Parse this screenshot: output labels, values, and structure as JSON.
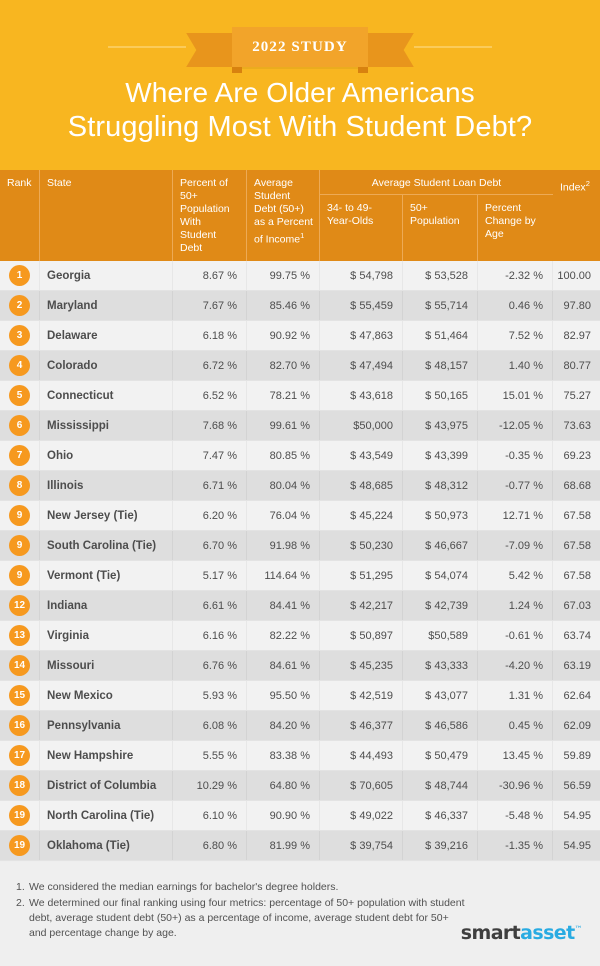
{
  "banner": {
    "ribbon_label": "2022 STUDY",
    "title_line1": "Where Are Older Americans",
    "title_line2": "Struggling Most With Student Debt?",
    "bg_color": "#F8B620",
    "ribbon_color": "#F2A42A"
  },
  "table": {
    "header": {
      "rank": "Rank",
      "state": "State",
      "percent_pop": "Percent of 50+ Population With Student Debt",
      "avg_debt_income": "Average Student Debt (50+) as a Percent of Income",
      "avg_debt_income_footnote": "1",
      "group_title": "Average Student Loan Debt",
      "group_col1": "34- to 49-Year-Olds",
      "group_col2": "50+ Population",
      "group_col3": "Percent Change by Age",
      "index": "Index",
      "index_footnote": "2"
    },
    "rows": [
      {
        "rank": "1",
        "state": "Georgia",
        "pct_pop": "8.67 %",
        "debt_income": "99.75 %",
        "debt_34_49": "$ 54,798",
        "debt_50p": "$ 53,528",
        "pct_change": "-2.32 %",
        "index": "100.00"
      },
      {
        "rank": "2",
        "state": "Maryland",
        "pct_pop": "7.67 %",
        "debt_income": "85.46 %",
        "debt_34_49": "$ 55,459",
        "debt_50p": "$  55,714",
        "pct_change": "0.46 %",
        "index": "97.80"
      },
      {
        "rank": "3",
        "state": "Delaware",
        "pct_pop": "6.18 %",
        "debt_income": "90.92 %",
        "debt_34_49": "$ 47,863",
        "debt_50p": "$  51,464",
        "pct_change": "7.52 %",
        "index": "82.97"
      },
      {
        "rank": "4",
        "state": "Colorado",
        "pct_pop": "6.72 %",
        "debt_income": "82.70 %",
        "debt_34_49": "$ 47,494",
        "debt_50p": "$  48,157",
        "pct_change": "1.40 %",
        "index": "80.77"
      },
      {
        "rank": "5",
        "state": "Connecticut",
        "pct_pop": "6.52 %",
        "debt_income": "78.21 %",
        "debt_34_49": "$  43,618",
        "debt_50p": "$ 50,165",
        "pct_change": "15.01 %",
        "index": "75.27"
      },
      {
        "rank": "6",
        "state": "Mississippi",
        "pct_pop": "7.68 %",
        "debt_income": "99.61 %",
        "debt_34_49": "$50,000",
        "debt_50p": "$ 43,975",
        "pct_change": "-12.05 %",
        "index": "73.63"
      },
      {
        "rank": "7",
        "state": "Ohio",
        "pct_pop": "7.47 %",
        "debt_income": "80.85 %",
        "debt_34_49": "$ 43,549",
        "debt_50p": "$ 43,399",
        "pct_change": "-0.35 %",
        "index": "69.23"
      },
      {
        "rank": "8",
        "state": "Illinois",
        "pct_pop": "6.71 %",
        "debt_income": "80.04 %",
        "debt_34_49": "$ 48,685",
        "debt_50p": "$  48,312",
        "pct_change": "-0.77 %",
        "index": "68.68"
      },
      {
        "rank": "9",
        "state": "New Jersey (Tie)",
        "pct_pop": "6.20 %",
        "debt_income": "76.04 %",
        "debt_34_49": "$ 45,224",
        "debt_50p": "$ 50,973",
        "pct_change": "12.71 %",
        "index": "67.58"
      },
      {
        "rank": "9",
        "state": "South Carolina (Tie)",
        "pct_pop": "6.70 %",
        "debt_income": "91.98 %",
        "debt_34_49": "$ 50,230",
        "debt_50p": "$ 46,667",
        "pct_change": "-7.09 %",
        "index": "67.58"
      },
      {
        "rank": "9",
        "state": "Vermont (Tie)",
        "pct_pop": "5.17 %",
        "debt_income": "114.64 %",
        "debt_34_49": "$  51,295",
        "debt_50p": "$ 54,074",
        "pct_change": "5.42 %",
        "index": "67.58"
      },
      {
        "rank": "12",
        "state": "Indiana",
        "pct_pop": "6.61 %",
        "debt_income": "84.41 %",
        "debt_34_49": "$  42,217",
        "debt_50p": "$ 42,739",
        "pct_change": "1.24 %",
        "index": "67.03"
      },
      {
        "rank": "13",
        "state": "Virginia",
        "pct_pop": "6.16 %",
        "debt_income": "82.22 %",
        "debt_34_49": "$ 50,897",
        "debt_50p": "$50,589",
        "pct_change": "-0.61 %",
        "index": "63.74"
      },
      {
        "rank": "14",
        "state": "Missouri",
        "pct_pop": "6.76 %",
        "debt_income": "84.61 %",
        "debt_34_49": "$ 45,235",
        "debt_50p": "$ 43,333",
        "pct_change": "-4.20 %",
        "index": "63.19"
      },
      {
        "rank": "15",
        "state": "New Mexico",
        "pct_pop": "5.93 %",
        "debt_income": "95.50 %",
        "debt_34_49": "$  42,519",
        "debt_50p": "$ 43,077",
        "pct_change": "1.31 %",
        "index": "62.64"
      },
      {
        "rank": "16",
        "state": "Pennsylvania",
        "pct_pop": "6.08 %",
        "debt_income": "84.20 %",
        "debt_34_49": "$ 46,377",
        "debt_50p": "$ 46,586",
        "pct_change": "0.45 %",
        "index": "62.09"
      },
      {
        "rank": "17",
        "state": "New Hampshire",
        "pct_pop": "5.55 %",
        "debt_income": "83.38 %",
        "debt_34_49": "$ 44,493",
        "debt_50p": "$ 50,479",
        "pct_change": "13.45 %",
        "index": "59.89"
      },
      {
        "rank": "18",
        "state": "District of Columbia",
        "pct_pop": "10.29 %",
        "debt_income": "64.80 %",
        "debt_34_49": "$ 70,605",
        "debt_50p": "$ 48,744",
        "pct_change": "-30.96 %",
        "index": "56.59"
      },
      {
        "rank": "19",
        "state": "North Carolina (Tie)",
        "pct_pop": "6.10 %",
        "debt_income": "90.90 %",
        "debt_34_49": "$ 49,022",
        "debt_50p": "$ 46,337",
        "pct_change": "-5.48 %",
        "index": "54.95"
      },
      {
        "rank": "19",
        "state": "Oklahoma (Tie)",
        "pct_pop": "6.80 %",
        "debt_income": "81.99 %",
        "debt_34_49": "$ 39,754",
        "debt_50p": "$ 39,216",
        "pct_change": "-1.35 %",
        "index": "54.95"
      }
    ]
  },
  "footer": {
    "note1_num": "1.",
    "note1_text": "We considered the median earnings for bachelor's degree holders.",
    "note2_num": "2.",
    "note2_text": "We determined our final ranking using four metrics: percentage of 50+ population with student debt, average student debt (50+) as a percentage of income, average student debt for 50+ and percentage change by age.",
    "logo_part1": "smart",
    "logo_part2": "asset"
  },
  "chart_data": {
    "type": "table",
    "title": "Where Are Older Americans Struggling Most With Student Debt?",
    "subtitle": "2022 STUDY",
    "columns": [
      "Rank",
      "State",
      "Percent of 50+ Population With Student Debt",
      "Average Student Debt (50+) as a Percent of Income",
      "Average Student Loan Debt: 34- to 49-Year-Olds",
      "Average Student Loan Debt: 50+ Population",
      "Average Student Loan Debt: Percent Change by Age",
      "Index"
    ],
    "rows": [
      [
        "1",
        "Georgia",
        8.67,
        99.75,
        54798,
        53528,
        -2.32,
        100.0
      ],
      [
        "2",
        "Maryland",
        7.67,
        85.46,
        55459,
        55714,
        0.46,
        97.8
      ],
      [
        "3",
        "Delaware",
        6.18,
        90.92,
        47863,
        51464,
        7.52,
        82.97
      ],
      [
        "4",
        "Colorado",
        6.72,
        82.7,
        47494,
        48157,
        1.4,
        80.77
      ],
      [
        "5",
        "Connecticut",
        6.52,
        78.21,
        43618,
        50165,
        15.01,
        75.27
      ],
      [
        "6",
        "Mississippi",
        7.68,
        99.61,
        50000,
        43975,
        -12.05,
        73.63
      ],
      [
        "7",
        "Ohio",
        7.47,
        80.85,
        43549,
        43399,
        -0.35,
        69.23
      ],
      [
        "8",
        "Illinois",
        6.71,
        80.04,
        48685,
        48312,
        -0.77,
        68.68
      ],
      [
        "9",
        "New Jersey (Tie)",
        6.2,
        76.04,
        45224,
        50973,
        12.71,
        67.58
      ],
      [
        "9",
        "South Carolina (Tie)",
        6.7,
        91.98,
        50230,
        46667,
        -7.09,
        67.58
      ],
      [
        "9",
        "Vermont (Tie)",
        5.17,
        114.64,
        51295,
        54074,
        5.42,
        67.58
      ],
      [
        "12",
        "Indiana",
        6.61,
        84.41,
        42217,
        42739,
        1.24,
        67.03
      ],
      [
        "13",
        "Virginia",
        6.16,
        82.22,
        50897,
        50589,
        -0.61,
        63.74
      ],
      [
        "14",
        "Missouri",
        6.76,
        84.61,
        45235,
        43333,
        -4.2,
        63.19
      ],
      [
        "15",
        "New Mexico",
        5.93,
        95.5,
        42519,
        43077,
        1.31,
        62.64
      ],
      [
        "16",
        "Pennsylvania",
        6.08,
        84.2,
        46377,
        46586,
        0.45,
        62.09
      ],
      [
        "17",
        "New Hampshire",
        5.55,
        83.38,
        44493,
        50479,
        13.45,
        59.89
      ],
      [
        "18",
        "District of Columbia",
        10.29,
        64.8,
        70605,
        48744,
        -30.96,
        56.59
      ],
      [
        "19",
        "North Carolina (Tie)",
        6.1,
        90.9,
        49022,
        46337,
        -5.48,
        54.95
      ],
      [
        "19",
        "Oklahoma (Tie)",
        6.8,
        81.99,
        39754,
        39216,
        -1.35,
        54.95
      ]
    ]
  }
}
